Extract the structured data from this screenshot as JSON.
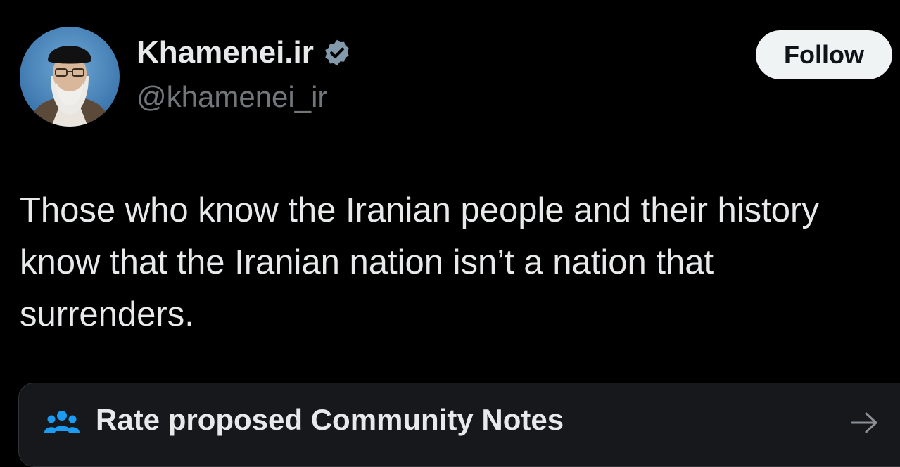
{
  "post": {
    "author": {
      "display_name": "Khamenei.ir",
      "handle": "@khamenei_ir",
      "verified": true,
      "avatar_icon": "profile-photo"
    },
    "follow_label": "Follow",
    "text_lines": [
      "Those who know the Iranian people and their history",
      "know that the Iranian nation isn’t a nation that",
      "surrenders."
    ]
  },
  "community_notes": {
    "label": "Rate proposed Community Notes",
    "icon": "people-group-icon",
    "arrow_icon": "arrow-right-icon"
  },
  "colors": {
    "background": "#000000",
    "primary_text": "#e7e9ea",
    "secondary_text": "#71767b",
    "verified_badge": "#829aab",
    "notes_icon": "#1d9bf0",
    "card_background": "#16181c"
  }
}
